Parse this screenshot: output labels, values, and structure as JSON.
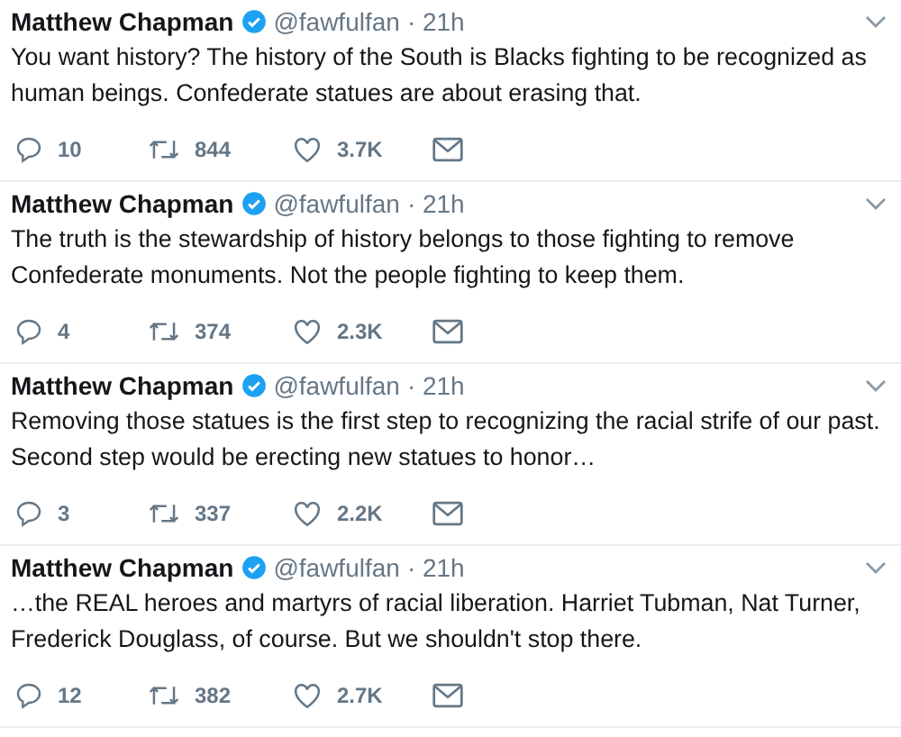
{
  "tweets": [
    {
      "name": "Matthew Chapman",
      "verified": true,
      "handle": "@fawfulfan",
      "time": "· 21h",
      "text": "You want history? The history of the South is Blacks fighting to be recognized as human beings. Confederate statues are about erasing that.",
      "replies": "10",
      "retweets": "844",
      "likes": "3.7K"
    },
    {
      "name": "Matthew Chapman",
      "verified": true,
      "handle": "@fawfulfan",
      "time": "· 21h",
      "text": "The truth is the stewardship of history belongs to those fighting to remove Confederate monuments. Not the people fighting to keep them.",
      "replies": "4",
      "retweets": "374",
      "likes": "2.3K"
    },
    {
      "name": "Matthew Chapman",
      "verified": true,
      "handle": "@fawfulfan",
      "time": "· 21h",
      "text": "Removing those statues is the first step to recognizing the racial strife of our past. Second step would be erecting new statues to honor…",
      "replies": "3",
      "retweets": "337",
      "likes": "2.2K"
    },
    {
      "name": "Matthew Chapman",
      "verified": true,
      "handle": "@fawfulfan",
      "time": "· 21h",
      "text": "…the REAL heroes and martyrs of racial liberation. Harriet Tubman, Nat Turner, Frederick Douglass, of course. But we shouldn't stop there.",
      "replies": "12",
      "retweets": "382",
      "likes": "2.7K"
    }
  ]
}
